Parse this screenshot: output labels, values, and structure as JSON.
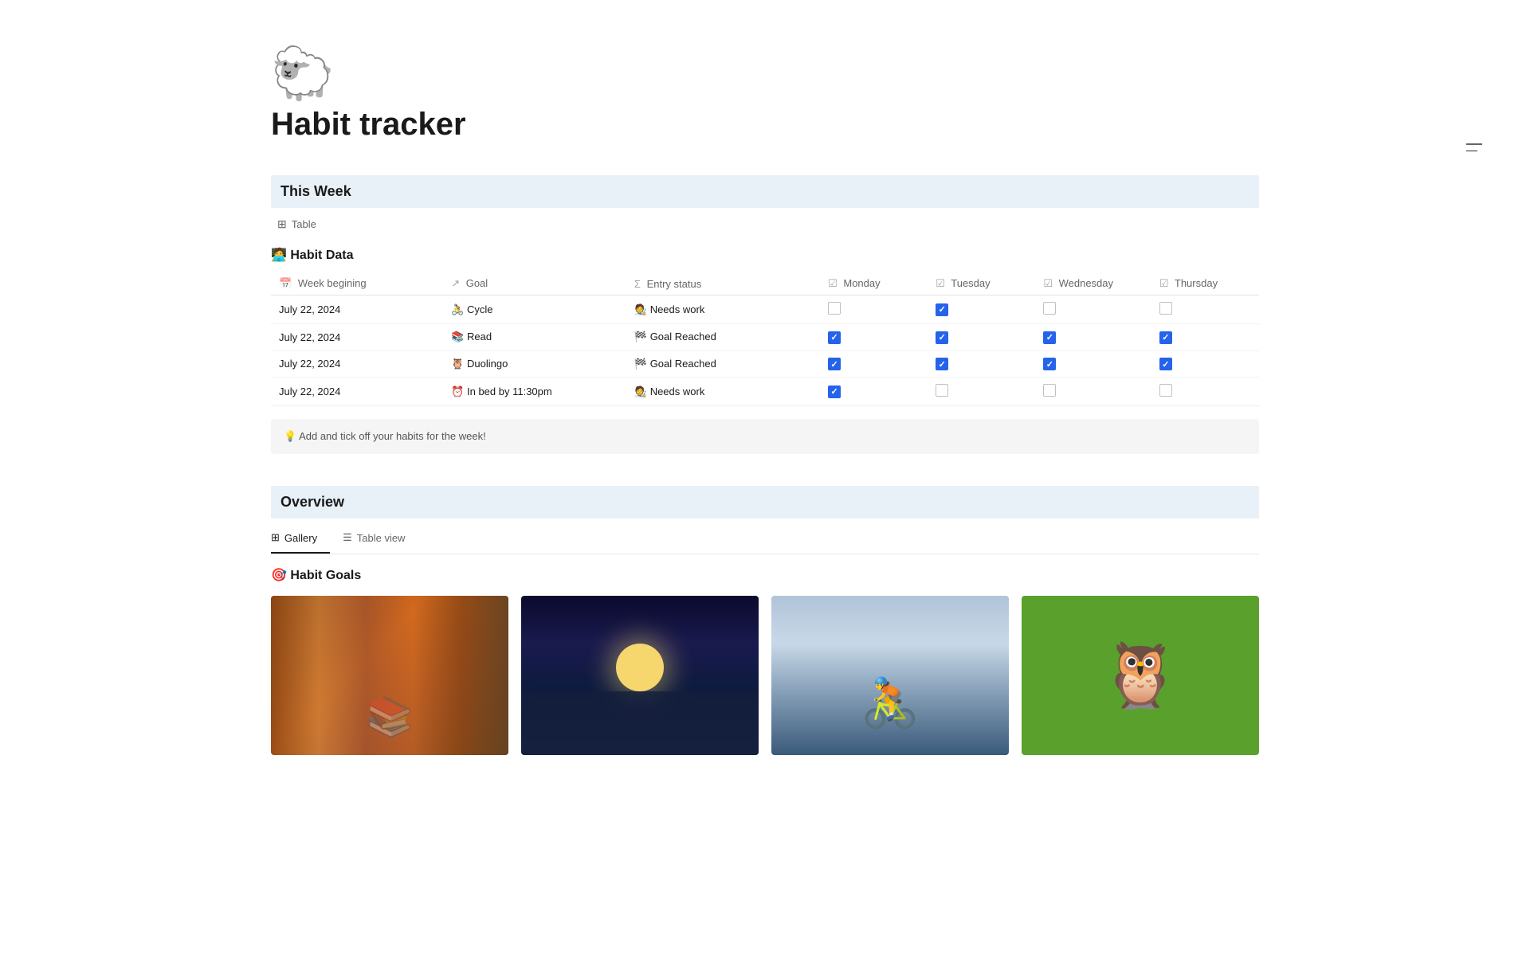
{
  "page": {
    "emoji": "🐑",
    "title": "Habit tracker"
  },
  "this_week": {
    "section_title": "This Week",
    "view_label": "Table",
    "habit_data_label": "🧑‍💻 Habit Data",
    "columns": {
      "week": "Week begining",
      "goal": "Goal",
      "entry_status": "Entry status",
      "monday": "Monday",
      "tuesday": "Tuesday",
      "wednesday": "Wednesday",
      "thursday": "Thursday"
    },
    "rows": [
      {
        "date": "July 22, 2024",
        "goal_emoji": "🚴",
        "goal": "Cycle",
        "status_emoji": "🧑‍🎨",
        "status": "Needs work",
        "monday": false,
        "tuesday": true,
        "wednesday": false,
        "thursday": false
      },
      {
        "date": "July 22, 2024",
        "goal_emoji": "📚",
        "goal": "Read",
        "status_emoji": "🏁",
        "status": "Goal Reached",
        "monday": true,
        "tuesday": true,
        "wednesday": true,
        "thursday": true
      },
      {
        "date": "July 22, 2024",
        "goal_emoji": "🦉",
        "goal": "Duolingo",
        "status_emoji": "🏁",
        "status": "Goal Reached",
        "monday": true,
        "tuesday": true,
        "wednesday": true,
        "thursday": true
      },
      {
        "date": "July 22, 2024",
        "goal_emoji": "⏰",
        "goal": "In bed by 11:30pm",
        "status_emoji": "🧑‍🎨",
        "status": "Needs work",
        "monday": true,
        "tuesday": false,
        "wednesday": false,
        "thursday": false
      }
    ],
    "tip": "💡 Add and tick off your habits for the week!"
  },
  "overview": {
    "section_title": "Overview",
    "tabs": [
      {
        "label": "Gallery",
        "icon": "⊞",
        "active": true
      },
      {
        "label": "Table view",
        "icon": "☰",
        "active": false
      }
    ],
    "habit_goals_label": "🎯 Habit Goals",
    "cards": [
      {
        "label": "Books",
        "type": "books"
      },
      {
        "label": "Night",
        "type": "night"
      },
      {
        "label": "Cycling",
        "type": "cycling"
      },
      {
        "label": "Duolingo",
        "type": "duolingo"
      }
    ]
  },
  "minimize_label": "—"
}
